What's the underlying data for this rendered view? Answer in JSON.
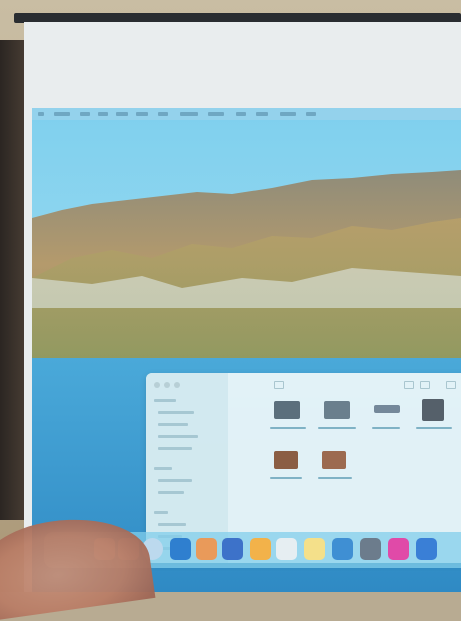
{
  "photo": {
    "subject": "projection-screen",
    "projected_os_view": {
      "menubar": {},
      "wallpaper": {},
      "finder_window": {
        "title": "",
        "sidebar_sections": 3,
        "files_row_1": 4,
        "files_row_2": 2
      },
      "dock": {
        "icons": [
          "finder-icon",
          "launchpad-icon",
          "safari-icon",
          "mail-icon",
          "photos-icon",
          "calendar-icon",
          "notes-icon",
          "reminders-icon",
          "maps-icon",
          "messages-icon",
          "facetime-icon",
          "music-icon",
          "settings-icon"
        ]
      }
    }
  }
}
